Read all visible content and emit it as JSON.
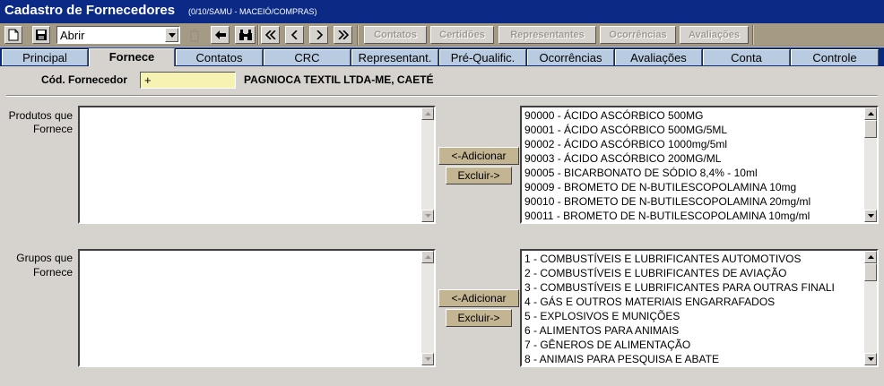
{
  "window": {
    "title": "Cadastro de Fornecedores",
    "subtitle": "(0/10/SAMU - MACEIÓ/COMPRAS)"
  },
  "toolbar": {
    "combo_value": "Abrir",
    "buttons": [
      "Contatos",
      "Certidões",
      "Representantes",
      "Ocorrências",
      "Avaliações"
    ]
  },
  "tabs": [
    "Principal",
    "Fornece",
    "Contatos",
    "CRC",
    "Representant.",
    "Pré-Qualific.",
    "Ocorrências",
    "Avaliações",
    "Conta",
    "Controle"
  ],
  "form": {
    "cod_label": "Cód. Fornecedor",
    "cod_value": "+",
    "supplier_name": "PAGNIOCA TEXTIL LTDA-ME, CAETÉ",
    "produtos_label_1": "Produtos que",
    "produtos_label_2": "Fornece",
    "grupos_label_1": "Grupos que",
    "grupos_label_2": "Fornece",
    "add_label": "<-Adicionar",
    "remove_label": "Excluir->"
  },
  "produtos": [
    "90000 - ÁCIDO ASCÓRBICO 500MG",
    "90001 - ÁCIDO ASCÓRBICO 500MG/5ML",
    "90002 - ÁCIDO ASCÓRBICO 1000mg/5ml",
    "90003 - ÁCIDO ASCÓRBICO 200MG/ML",
    "90005 - BICARBONATO DE SÓDIO 8,4% - 10ml",
    "90009 - BROMETO DE N-BUTILESCOPOLAMINA 10mg",
    "90010 - BROMETO DE N-BUTILESCOPOLAMINA 20mg/ml",
    "90011 - BROMETO DE N-BUTILESCOPOLAMINA 10mg/ml"
  ],
  "grupos": [
    "1 - COMBUSTÍVEIS E LUBRIFICANTES AUTOMOTIVOS",
    "2 - COMBUSTÍVEIS E LUBRIFICANTES DE AVIAÇÃO",
    "3 - COMBUSTÍVEIS E LUBRIFICANTES PARA OUTRAS FINALI",
    "4 - GÁS E OUTROS MATERIAIS ENGARRAFADOS",
    "5 - EXPLOSIVOS E MUNIÇÕES",
    "6 - ALIMENTOS PARA ANIMAIS",
    "7 - GÊNEROS DE ALIMENTAÇÃO",
    "8 - ANIMAIS PARA PESQUISA E ABATE"
  ]
}
